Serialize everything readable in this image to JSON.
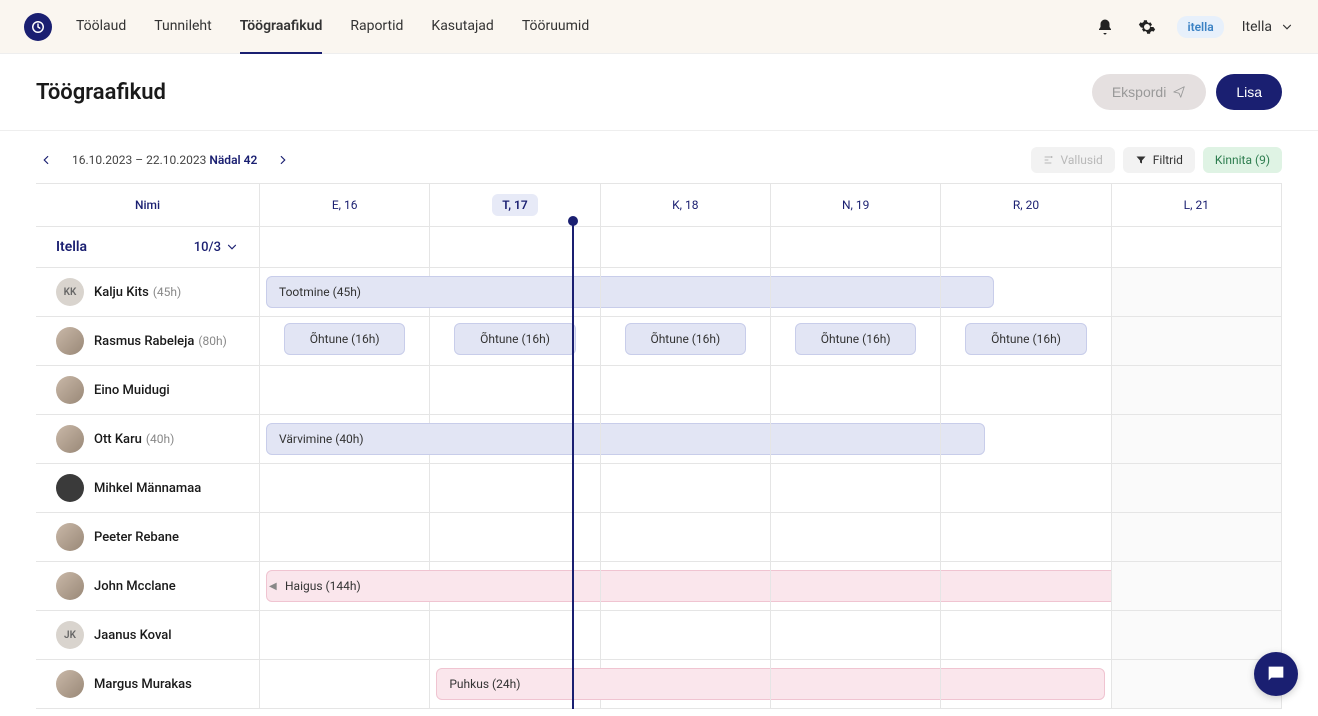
{
  "nav": {
    "items": [
      {
        "label": "Töölaud",
        "active": false
      },
      {
        "label": "Tunnileht",
        "active": false
      },
      {
        "label": "Töögraafikud",
        "active": true
      },
      {
        "label": "Raportid",
        "active": false
      },
      {
        "label": "Kasutajad",
        "active": false
      },
      {
        "label": "Tööruumid",
        "active": false
      }
    ]
  },
  "header": {
    "org_badge": "itella",
    "org_name": "Itella"
  },
  "page": {
    "title": "Töögraafikud",
    "export_label": "Ekspordi",
    "add_label": "Lisa"
  },
  "toolbar": {
    "date_range": "16.10.2023 – 22.10.2023",
    "week_label": "Nädal 42",
    "groups_label": "Vallusid",
    "filters_label": "Filtrid",
    "confirm_label": "Kinnita (9)"
  },
  "columns": {
    "name_header": "Nimi",
    "days": [
      {
        "label": "E, 16",
        "today": false,
        "weekend": false
      },
      {
        "label": "T, 17",
        "today": true,
        "weekend": false
      },
      {
        "label": "K, 18",
        "today": false,
        "weekend": false
      },
      {
        "label": "N, 19",
        "today": false,
        "weekend": false
      },
      {
        "label": "R, 20",
        "today": false,
        "weekend": false
      },
      {
        "label": "L, 21",
        "today": false,
        "weekend": true
      }
    ]
  },
  "group": {
    "name": "Itella",
    "count": "10/3"
  },
  "people": [
    {
      "name": "Kalju Kits",
      "hours": "(45h)",
      "initials": "KK",
      "avatar_type": "initials",
      "spans": [
        {
          "label": "Tootmine (45h)",
          "start": 0,
          "end_fraction": 4.35,
          "kind": "blue"
        }
      ],
      "shifts": []
    },
    {
      "name": "Rasmus Rabeleja",
      "hours": "(80h)",
      "initials": "",
      "avatar_type": "photo",
      "spans": [],
      "shifts": [
        {
          "day": 0,
          "label": "Õhtune (16h)"
        },
        {
          "day": 1,
          "label": "Õhtune (16h)"
        },
        {
          "day": 2,
          "label": "Õhtune (16h)"
        },
        {
          "day": 3,
          "label": "Õhtune (16h)"
        },
        {
          "day": 4,
          "label": "Õhtune (16h)"
        }
      ]
    },
    {
      "name": "Eino Muidugi",
      "hours": "",
      "initials": "",
      "avatar_type": "photo",
      "spans": [],
      "shifts": []
    },
    {
      "name": "Ott Karu",
      "hours": "(40h)",
      "initials": "",
      "avatar_type": "photo",
      "spans": [
        {
          "label": "Värvimine (40h)",
          "start": 0,
          "end_fraction": 4.3,
          "kind": "blue"
        }
      ],
      "shifts": []
    },
    {
      "name": "Mihkel Männamaa",
      "hours": "",
      "initials": "",
      "avatar_type": "dark",
      "spans": [],
      "shifts": []
    },
    {
      "name": "Peeter Rebane",
      "hours": "",
      "initials": "",
      "avatar_type": "photo",
      "spans": [],
      "shifts": []
    },
    {
      "name": "John Mcclane",
      "hours": "",
      "initials": "",
      "avatar_type": "photo",
      "spans": [
        {
          "label": "Haigus (144h)",
          "start": 0,
          "end_fraction": 6,
          "kind": "pink",
          "overflow_left": true,
          "overflow_right": true
        }
      ],
      "shifts": []
    },
    {
      "name": "Jaanus Koval",
      "hours": "",
      "initials": "JK",
      "avatar_type": "initials",
      "spans": [],
      "shifts": []
    },
    {
      "name": "Margus Murakas",
      "hours": "",
      "initials": "",
      "avatar_type": "photo",
      "spans": [
        {
          "label": "Puhkus (24h)",
          "start": 1,
          "end_fraction": 5,
          "kind": "pink"
        }
      ],
      "shifts": []
    }
  ],
  "timeline_fraction": 1.83
}
